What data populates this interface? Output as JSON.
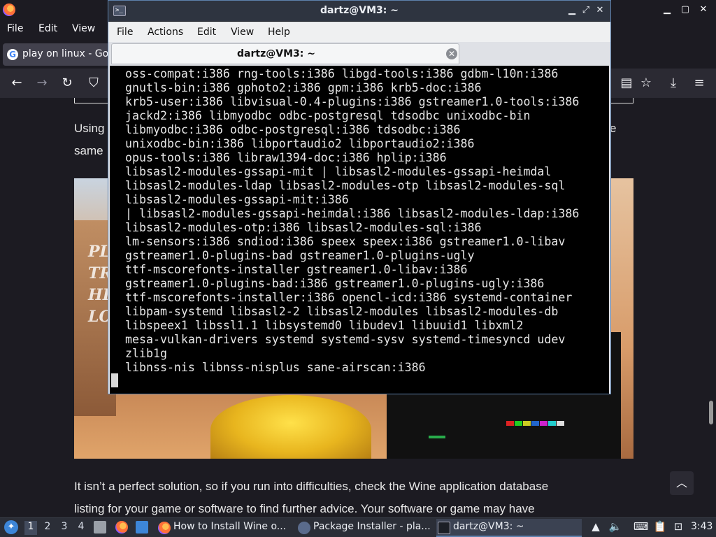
{
  "firefox": {
    "window_controls": {
      "minimize": "▁",
      "maximize": "▢",
      "close": "✕"
    },
    "menu": {
      "file": "File",
      "edit": "Edit",
      "view": "View"
    },
    "tab_title": "play on linux - Goo",
    "article": {
      "line1_left": "Using",
      "line1_right": "e",
      "line2_left": "same",
      "image_menu_lines": [
        "PL",
        "TRA",
        "HE",
        "LO"
      ],
      "paragraph_line1": "It isn’t a perfect solution, so if you run into difficulties, check the Wine application database",
      "paragraph_line2": "listing for your game or software to find further advice. Your software or game may have"
    },
    "scroll_top_icon": "︿"
  },
  "terminal": {
    "title": "dartz@VM3: ~",
    "icon_glyph": ">_",
    "window_controls": {
      "minimize": "▁",
      "maximize": "⤢",
      "close": "✕"
    },
    "menu": {
      "file": "File",
      "actions": "Actions",
      "edit": "Edit",
      "view": "View",
      "help": "Help"
    },
    "tab_title": "dartz@VM3: ~",
    "tab_close": "✕",
    "output_lines": [
      "oss-compat:i386 rng-tools:i386 libgd-tools:i386 gdbm-l10n:i386",
      "gnutls-bin:i386 gphoto2:i386 gpm:i386 krb5-doc:i386",
      "krb5-user:i386 libvisual-0.4-plugins:i386 gstreamer1.0-tools:i386",
      "jackd2:i386 libmyodbc odbc-postgresql tdsodbc unixodbc-bin",
      "libmyodbc:i386 odbc-postgresql:i386 tdsodbc:i386",
      "unixodbc-bin:i386 libportaudio2 libportaudio2:i386",
      "opus-tools:i386 libraw1394-doc:i386 hplip:i386",
      "libsasl2-modules-gssapi-mit | libsasl2-modules-gssapi-heimdal",
      "libsasl2-modules-ldap libsasl2-modules-otp libsasl2-modules-sql",
      "libsasl2-modules-gssapi-mit:i386",
      "| libsasl2-modules-gssapi-heimdal:i386 libsasl2-modules-ldap:i386",
      "libsasl2-modules-otp:i386 libsasl2-modules-sql:i386",
      "lm-sensors:i386 sndiod:i386 speex speex:i386 gstreamer1.0-libav",
      "gstreamer1.0-plugins-bad gstreamer1.0-plugins-ugly",
      "ttf-mscorefonts-installer gstreamer1.0-libav:i386",
      "gstreamer1.0-plugins-bad:i386 gstreamer1.0-plugins-ugly:i386",
      "ttf-mscorefonts-installer:i386 opencl-icd:i386 systemd-container",
      "libpam-systemd libsasl2-2 libsasl2-modules libsasl2-modules-db",
      "libspeex1 libssl1.1 libsystemd0 libudev1 libuuid1 libxml2",
      "mesa-vulkan-drivers systemd systemd-sysv systemd-timesyncd udev",
      "zlib1g",
      "libnss-nis libnss-nisplus sane-airscan:i386"
    ]
  },
  "taskbar": {
    "start_icon": "✦",
    "workspaces": [
      "1",
      "2",
      "3",
      "4"
    ],
    "tasks": [
      {
        "label": "How to Install Wine o...",
        "icon": "firefox-icon"
      },
      {
        "label": "Package Installer - pla...",
        "icon": "package-installer-icon"
      },
      {
        "label": "dartz@VM3: ~",
        "icon": "terminal-icon"
      }
    ],
    "clock": "3:43"
  }
}
